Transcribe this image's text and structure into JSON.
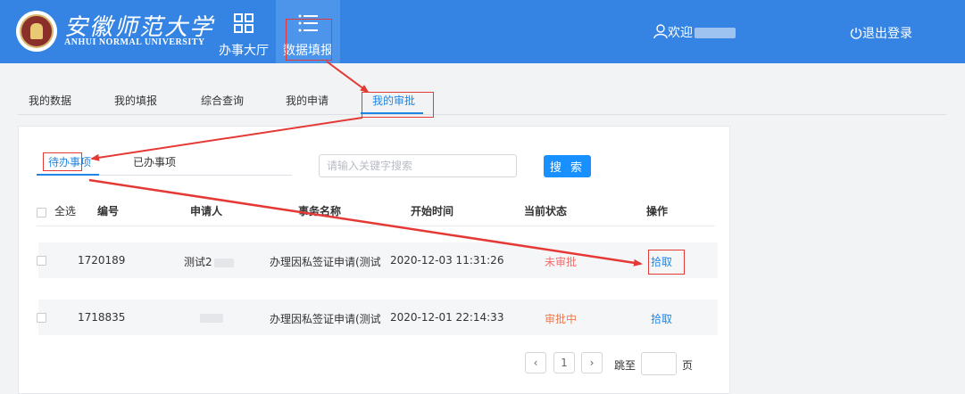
{
  "header": {
    "brand_cn": "安徽师范大学",
    "brand_en": "ANHUI NORMAL UNIVERSITY",
    "nav": [
      {
        "label": "办事大厅",
        "icon": "grid-icon"
      },
      {
        "label": "数据填报",
        "icon": "list-icon"
      }
    ],
    "welcome": "欢迎",
    "logout": "退出登录"
  },
  "subtabs": [
    "我的数据",
    "我的填报",
    "综合查询",
    "我的申请",
    "我的审批"
  ],
  "inner_tabs": [
    "待办事项",
    "已办事项"
  ],
  "search": {
    "placeholder": "请输入关键字搜索",
    "button": "搜 索"
  },
  "table": {
    "headers": [
      "全选",
      "编号",
      "申请人",
      "事务名称",
      "开始时间",
      "当前状态",
      "操作"
    ],
    "rows": [
      {
        "id": "1720189",
        "applicant": "测试2",
        "name": "办理因私签证申请(测试",
        "start": "2020-12-03 11:31:26",
        "status": "未审批",
        "action": "拾取"
      },
      {
        "id": "1718835",
        "applicant": "",
        "name": "办理因私签证申请(测试",
        "start": "2020-12-01 22:14:33",
        "status": "审批中",
        "action": "拾取"
      }
    ]
  },
  "pager": {
    "current": "1",
    "prev": "‹",
    "next": "›",
    "jump_label": "跳至",
    "page_suffix": "页"
  },
  "colors": {
    "header": "#3584e4",
    "accent": "#1f86e5",
    "annotation": "#e53935"
  }
}
